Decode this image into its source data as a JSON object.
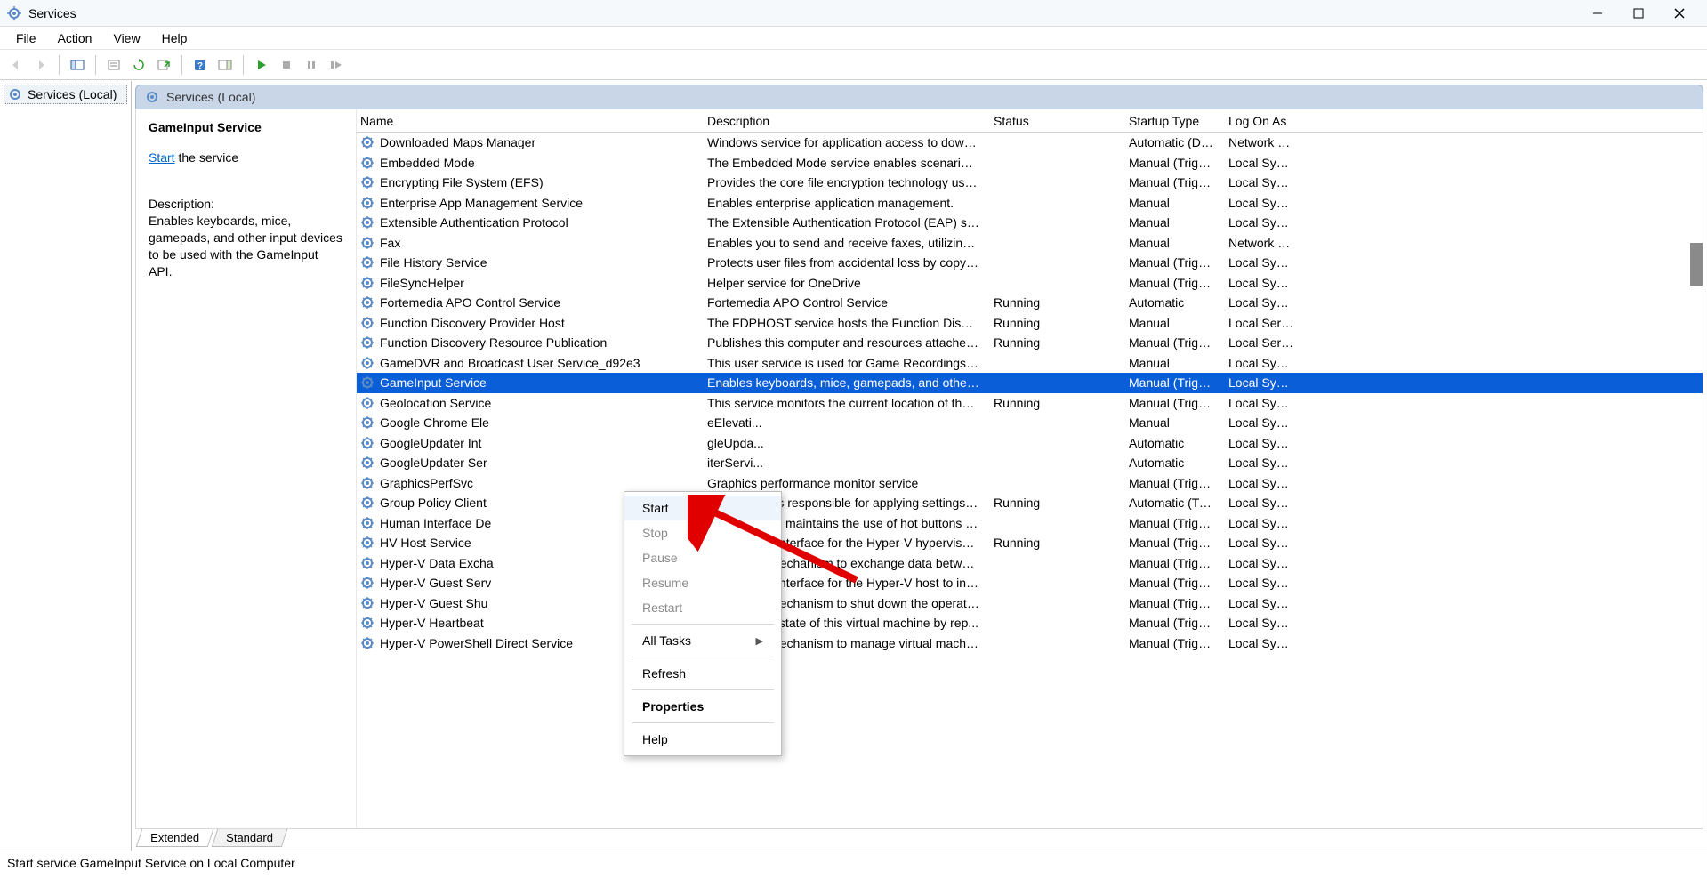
{
  "window": {
    "title": "Services",
    "status_bar": "Start service GameInput Service on Local Computer"
  },
  "menubar": {
    "file": "File",
    "action": "Action",
    "view": "View",
    "help": "Help"
  },
  "tree": {
    "root": "Services (Local)"
  },
  "content_header": "Services (Local)",
  "detail": {
    "name": "GameInput Service",
    "link_label": "Start",
    "link_suffix": " the service",
    "desc_label": "Description:",
    "desc_text": "Enables keyboards, mice, gamepads, and other input devices to be used with the GameInput API."
  },
  "columns": {
    "name": "Name",
    "desc": "Description",
    "status": "Status",
    "startup": "Startup Type",
    "logon": "Log On As"
  },
  "services": [
    {
      "name": "Downloaded Maps Manager",
      "desc": "Windows service for application access to downl...",
      "status": "",
      "startup": "Automatic (De...",
      "logon": "Network Se..."
    },
    {
      "name": "Embedded Mode",
      "desc": "The Embedded Mode service enables scenarios r...",
      "status": "",
      "startup": "Manual (Trigg...",
      "logon": "Local System"
    },
    {
      "name": "Encrypting File System (EFS)",
      "desc": "Provides the core file encryption technology use...",
      "status": "",
      "startup": "Manual (Trigg...",
      "logon": "Local System"
    },
    {
      "name": "Enterprise App Management Service",
      "desc": "Enables enterprise application management.",
      "status": "",
      "startup": "Manual",
      "logon": "Local System"
    },
    {
      "name": "Extensible Authentication Protocol",
      "desc": "The Extensible Authentication Protocol (EAP) serv...",
      "status": "",
      "startup": "Manual",
      "logon": "Local System"
    },
    {
      "name": "Fax",
      "desc": "Enables you to send and receive faxes, utilizing f...",
      "status": "",
      "startup": "Manual",
      "logon": "Network Se..."
    },
    {
      "name": "File History Service",
      "desc": "Protects user files from accidental loss by copyin...",
      "status": "",
      "startup": "Manual (Trigg...",
      "logon": "Local System"
    },
    {
      "name": "FileSyncHelper",
      "desc": "Helper service for OneDrive",
      "status": "",
      "startup": "Manual (Trigg...",
      "logon": "Local System"
    },
    {
      "name": "Fortemedia APO Control Service",
      "desc": "Fortemedia APO Control Service",
      "status": "Running",
      "startup": "Automatic",
      "logon": "Local System"
    },
    {
      "name": "Function Discovery Provider Host",
      "desc": "The FDPHOST service hosts the Function Discove...",
      "status": "Running",
      "startup": "Manual",
      "logon": "Local Service"
    },
    {
      "name": "Function Discovery Resource Publication",
      "desc": "Publishes this computer and resources attached t...",
      "status": "Running",
      "startup": "Manual (Trigg...",
      "logon": "Local Service"
    },
    {
      "name": "GameDVR and Broadcast User Service_d92e3",
      "desc": "This user service is used for Game Recordings an...",
      "status": "",
      "startup": "Manual",
      "logon": "Local System"
    },
    {
      "name": "GameInput Service",
      "desc": "Enables keyboards, mice, gamepads, and other in...",
      "status": "",
      "startup": "Manual (Trigg...",
      "logon": "Local System",
      "selected": true
    },
    {
      "name": "Geolocation Service",
      "desc": "This service monitors the current location of the ...",
      "status": "Running",
      "startup": "Manual (Trigg...",
      "logon": "Local System"
    },
    {
      "name": "Google Chrome Ele",
      "desc": "eElevati...",
      "status": "",
      "startup": "Manual",
      "logon": "Local System"
    },
    {
      "name": "GoogleUpdater Int",
      "desc": "gleUpda...",
      "status": "",
      "startup": "Automatic",
      "logon": "Local System"
    },
    {
      "name": "GoogleUpdater Ser",
      "desc": "iterServi...",
      "status": "",
      "startup": "Automatic",
      "logon": "Local System"
    },
    {
      "name": "GraphicsPerfSvc",
      "desc": "Graphics performance monitor service",
      "status": "",
      "startup": "Manual (Trigg...",
      "logon": "Local System"
    },
    {
      "name": "Group Policy Client",
      "desc": "The service is responsible for applying settings c...",
      "status": "Running",
      "startup": "Automatic (Tri...",
      "logon": "Local System"
    },
    {
      "name": "Human Interface De",
      "desc": "Activates and maintains the use of hot buttons o...",
      "status": "",
      "startup": "Manual (Trigg...",
      "logon": "Local System"
    },
    {
      "name": "HV Host Service",
      "desc": "Provides an interface for the Hyper-V hypervisor ...",
      "status": "Running",
      "startup": "Manual (Trigg...",
      "logon": "Local System"
    },
    {
      "name": "Hyper-V Data Excha",
      "desc": "Provides a mechanism to exchange data between...",
      "status": "",
      "startup": "Manual (Trigg...",
      "logon": "Local System"
    },
    {
      "name": "Hyper-V Guest Serv",
      "desc": "Provides an interface for the Hyper-V host to int...",
      "status": "",
      "startup": "Manual (Trigg...",
      "logon": "Local System"
    },
    {
      "name": "Hyper-V Guest Shu",
      "desc": "Provides a mechanism to shut down the operatin...",
      "status": "",
      "startup": "Manual (Trigg...",
      "logon": "Local System"
    },
    {
      "name": "Hyper-V Heartbeat",
      "desc": "Monitors the state of this virtual machine by rep...",
      "status": "",
      "startup": "Manual (Trigg...",
      "logon": "Local System"
    },
    {
      "name": "Hyper-V PowerShell Direct Service",
      "desc": "Provides a mechanism to manage virtual machin...",
      "status": "",
      "startup": "Manual (Trigg...",
      "logon": "Local System"
    }
  ],
  "context_menu": {
    "start": "Start",
    "stop": "Stop",
    "pause": "Pause",
    "resume": "Resume",
    "restart": "Restart",
    "all_tasks": "All Tasks",
    "refresh": "Refresh",
    "properties": "Properties",
    "help": "Help"
  },
  "tabs": {
    "extended": "Extended",
    "standard": "Standard"
  }
}
